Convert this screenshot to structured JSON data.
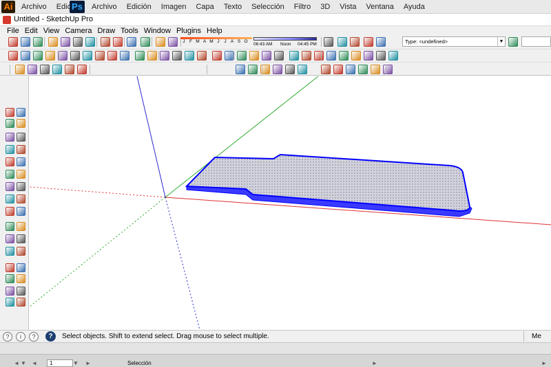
{
  "adobe": {
    "illustrator_badge": "Ai",
    "illustrator_menu": [
      "Archivo",
      "Edición"
    ],
    "photoshop_badge": "Ps",
    "photoshop_menu": [
      "Archivo",
      "Edición",
      "Imagen",
      "Capa",
      "Texto",
      "Selección",
      "Filtro",
      "3D",
      "Vista",
      "Ventana",
      "Ayuda"
    ]
  },
  "window": {
    "title": "Untitled - SketchUp Pro"
  },
  "menu": [
    "File",
    "Edit",
    "View",
    "Camera",
    "Draw",
    "Tools",
    "Window",
    "Plugins",
    "Help"
  ],
  "shadow": {
    "months": [
      "J",
      "F",
      "M",
      "A",
      "M",
      "J",
      "J",
      "A",
      "S",
      "O",
      "N",
      "D"
    ],
    "time_start": "06:43 AM",
    "time_noon": "Noon",
    "time_end": "04:45 PM"
  },
  "type_selector": {
    "value": "Type: <undefined>",
    "arrow": "▼"
  },
  "status": {
    "message": "Select objects. Shift to extend select. Drag mouse to select multiple.",
    "help_icon": "?",
    "info_icons": [
      "?",
      "i",
      "?"
    ],
    "measure_label": "Me"
  },
  "bottom": {
    "page_value": "1",
    "tool_name": "Selección"
  },
  "colors": {
    "axis_red": "#e03030",
    "axis_green": "#2faa2f",
    "axis_blue": "#2a2ad0",
    "selection_blue": "#0000ff",
    "face_fill": "#c8c8d8"
  },
  "icons": {
    "top_toolbar_1": [
      "new-file-icon",
      "open-icon",
      "save-icon",
      "cut-icon",
      "copy-icon",
      "paste-icon",
      "erase-icon",
      "undo-icon",
      "redo-icon",
      "print-icon",
      "model-info-icon",
      "send-to-layout-icon",
      "shadows-icon",
      "fog-icon",
      "component-browser-icon",
      "play-icon",
      "record-icon",
      "stop-icon",
      "style-icon",
      "model-info-icon-2"
    ],
    "top_toolbar_2": [
      "select-icon",
      "make-component-icon",
      "paint-bucket-icon",
      "eraser-icon",
      "rectangle-icon",
      "line-icon",
      "circle-icon",
      "arc-icon",
      "polygon-icon",
      "freehand-icon",
      "move-icon",
      "push-pull-icon",
      "rotate-icon",
      "follow-me-icon",
      "scale-icon",
      "offset-icon",
      "tape-measure-icon",
      "dimension-icon",
      "protractor-icon",
      "text-icon",
      "axes-icon",
      "3d-text-icon",
      "orbit-icon",
      "pan-icon",
      "zoom-icon",
      "zoom-window-icon",
      "zoom-extents-icon",
      "position-camera-icon",
      "walk-icon",
      "look-around-icon",
      "section-plane-icon"
    ],
    "top_toolbar_3": [
      "sandbox-icon",
      "smoove-icon",
      "stamp-icon",
      "drape-icon",
      "add-detail-icon",
      "flip-edge-icon",
      "iso-view-icon",
      "top-view-icon",
      "front-view-icon",
      "right-view-icon",
      "back-view-icon",
      "left-view-icon",
      "xray-icon",
      "wireframe-icon",
      "hidden-line-icon",
      "shaded-icon",
      "shaded-texture-icon",
      "monochrome-icon"
    ],
    "left_toolbar": [
      "select-icon",
      "make-component-icon",
      "paint-bucket-icon",
      "eraser-icon",
      "rectangle-icon",
      "line-icon",
      "circle-icon",
      "arc-icon",
      "polygon-icon",
      "freehand-icon",
      "move-icon",
      "push-pull-icon",
      "rotate-icon",
      "follow-me-icon",
      "scale-icon",
      "offset-icon",
      "tape-measure-icon",
      "dimension-icon",
      "protractor-icon",
      "text-icon",
      "axes-icon",
      "3d-text-icon",
      "orbit-icon",
      "pan-icon",
      "zoom-icon",
      "zoom-window-icon",
      "zoom-extents-icon",
      "previous-view-icon",
      "position-camera-icon",
      "walk-icon",
      "look-around-icon",
      "section-plane-icon"
    ]
  }
}
